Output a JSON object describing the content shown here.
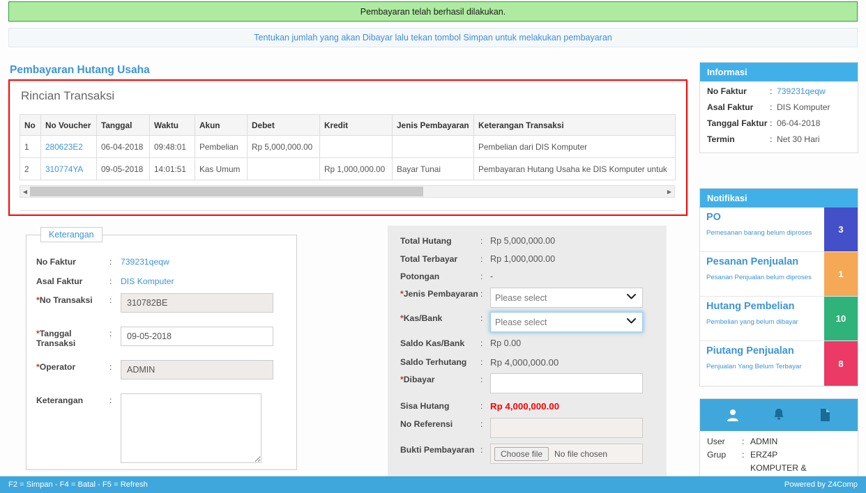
{
  "alerts": {
    "success": "Pembayaran telah berhasil dilakukan.",
    "info": "Tentukan jumlah yang akan Dibayar lalu tekan tombol Simpan untuk melakukan pembayaran"
  },
  "page_title": "Pembayaran Hutang Usaha",
  "transaksi": {
    "section_title": "Rincian Transaksi",
    "columns": [
      "No",
      "No Voucher",
      "Tanggal",
      "Waktu",
      "Akun",
      "Debet",
      "Kredit",
      "Jenis Pembayaran",
      "Keterangan Transaksi"
    ],
    "rows": [
      {
        "no": "1",
        "voucher": "280623E2",
        "tanggal": "06-04-2018",
        "waktu": "09:48:01",
        "akun": "Pembelian",
        "debet": "Rp 5,000,000.00",
        "kredit": "",
        "jenis": "",
        "keterangan": "Pembelian dari DIS Komputer"
      },
      {
        "no": "2",
        "voucher": "310774YA",
        "tanggal": "09-05-2018",
        "waktu": "14:01:51",
        "akun": "Kas Umum",
        "debet": "",
        "kredit": "Rp 1,000,000.00",
        "jenis": "Bayar Tunai",
        "keterangan": "Pembayaran Hutang Usaha ke DIS Komputer untuk"
      }
    ]
  },
  "keterangan_form": {
    "legend": "Keterangan",
    "no_faktur_label": "No Faktur",
    "no_faktur_value": "739231qeqw",
    "asal_faktur_label": "Asal Faktur",
    "asal_faktur_value": "DIS Komputer",
    "no_transaksi_label": "No Transaksi",
    "no_transaksi_value": "310782BE",
    "tanggal_transaksi_label": "Tanggal Transaksi",
    "tanggal_transaksi_value": "09-05-2018",
    "operator_label": "Operator",
    "operator_value": "ADMIN",
    "keterangan_label": "Keterangan",
    "keterangan_value": ""
  },
  "payment": {
    "total_hutang_label": "Total Hutang",
    "total_hutang_value": "Rp 5,000,000.00",
    "total_terbayar_label": "Total Terbayar",
    "total_terbayar_value": "Rp 1,000,000.00",
    "potongan_label": "Potongan",
    "potongan_value": "-",
    "jenis_pembayaran_label": "Jenis Pembayaran",
    "jenis_pembayaran_value": "Please select",
    "kas_bank_label": "Kas/Bank",
    "kas_bank_value": "Please select",
    "saldo_kas_bank_label": "Saldo Kas/Bank",
    "saldo_kas_bank_value": "Rp 0.00",
    "saldo_terhutang_label": "Saldo Terhutang",
    "saldo_terhutang_value": "Rp 4,000,000.00",
    "dibayar_label": "Dibayar",
    "dibayar_value": "",
    "sisa_hutang_label": "Sisa Hutang",
    "sisa_hutang_value": "Rp 4,000,000.00",
    "no_referensi_label": "No Referensi",
    "no_referensi_value": "",
    "bukti_pembayaran_label": "Bukti Pembayaran",
    "file_button_label": "Choose file",
    "file_status_text": "No file chosen"
  },
  "informasi": {
    "title": "Informasi",
    "rows": [
      {
        "label": "No Faktur",
        "value": "739231qeqw",
        "link": true
      },
      {
        "label": "Asal Faktur",
        "value": "DIS Komputer",
        "link": false
      },
      {
        "label": "Tanggal Faktur",
        "value": "06-04-2018",
        "link": false
      },
      {
        "label": "Termin",
        "value": "Net 30 Hari",
        "link": false
      }
    ]
  },
  "notifikasi": {
    "title": "Notifikasi",
    "items": [
      {
        "title": "PO",
        "subtitle": "Pemesanan barang belum diproses",
        "count": "3",
        "color": "#4350c8"
      },
      {
        "title": "Pesanan Penjualan",
        "subtitle": "Pesanan Penjualan belum diproses",
        "count": "1",
        "color": "#f5a košice"
      },
      {
        "title": "Hutang Pembelian",
        "subtitle": "Pembelian yang belum dibayar",
        "count": "10",
        "color": "#2fb37a"
      },
      {
        "title": "Piutang Penjualan",
        "subtitle": "Penjualan Yang Belum Terbayar",
        "count": "8",
        "color": "#ea3a65"
      }
    ]
  },
  "user_panel": {
    "icons": [
      "user-icon",
      "bell-icon",
      "document-icon"
    ],
    "user_label": "User",
    "user_value": "ADMIN",
    "grup_label": "Grup",
    "grup_value": "ERZ4P",
    "grup_value_line2": "KOMPUTER &"
  },
  "footer": {
    "shortcuts": "F2 = Simpan - F4 = Batal - F5 = Refresh",
    "powered_by": "Powered by Z4Comp"
  },
  "colors": {
    "brand_blue": "#3d94d9",
    "header_blue": "#41b0e8",
    "footer_blue": "#3fa7dc",
    "alert_green_bg": "#aeeba1",
    "alert_green_border": "#2e9e3e",
    "highlight_red": "#ff0000"
  }
}
